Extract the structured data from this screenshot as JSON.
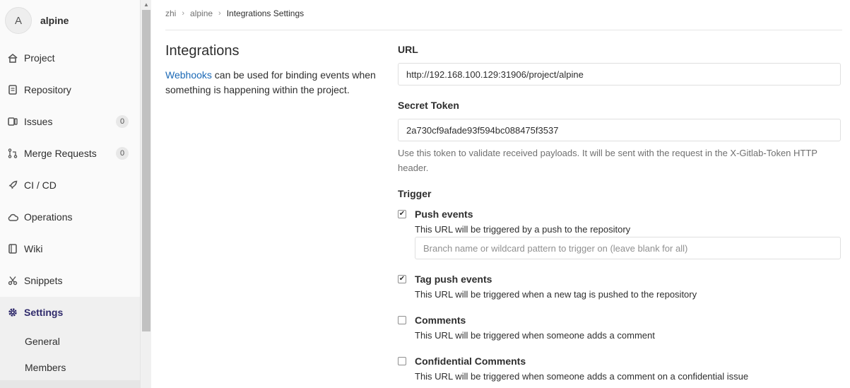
{
  "sidebar": {
    "avatar_letter": "A",
    "project_name": "alpine",
    "items": [
      {
        "label": "Project",
        "icon": "home-icon"
      },
      {
        "label": "Repository",
        "icon": "doc-icon"
      },
      {
        "label": "Issues",
        "icon": "issues-icon",
        "count": "0"
      },
      {
        "label": "Merge Requests",
        "icon": "merge-request-icon",
        "count": "0"
      },
      {
        "label": "CI / CD",
        "icon": "rocket-icon"
      },
      {
        "label": "Operations",
        "icon": "cloud-gear-icon"
      },
      {
        "label": "Wiki",
        "icon": "book-icon"
      },
      {
        "label": "Snippets",
        "icon": "scissors-icon"
      },
      {
        "label": "Settings",
        "icon": "settings-icon",
        "active": true
      }
    ],
    "sub_items": [
      {
        "label": "General"
      },
      {
        "label": "Members"
      }
    ]
  },
  "breadcrumb": {
    "items": [
      "zhi",
      "alpine"
    ],
    "current": "Integrations Settings"
  },
  "intro": {
    "title": "Integrations",
    "link_text": "Webhooks",
    "text": " can be used for binding events when something is happening within the project."
  },
  "form": {
    "url_label": "URL",
    "url_value": "http://192.168.100.129:31906/project/alpine",
    "token_label": "Secret Token",
    "token_value": "2a730cf9afade93f594bc088475f3537",
    "token_help": "Use this token to validate received payloads. It will be sent with the request in the X-Gitlab-Token HTTP header.",
    "trigger_label": "Trigger",
    "branch_placeholder": "Branch name or wildcard pattern to trigger on (leave blank for all)"
  },
  "triggers": [
    {
      "label": "Push events",
      "help": "This URL will be triggered by a push to the repository",
      "checked": true
    },
    {
      "label": "Tag push events",
      "help": "This URL will be triggered when a new tag is pushed to the repository",
      "checked": true
    },
    {
      "label": "Comments",
      "help": "This URL will be triggered when someone adds a comment",
      "checked": false
    },
    {
      "label": "Confidential Comments",
      "help": "This URL will be triggered when someone adds a comment on a confidential issue",
      "checked": false
    }
  ],
  "colors": {
    "active_nav": "#2f2a6b",
    "link": "#1b69b6"
  }
}
